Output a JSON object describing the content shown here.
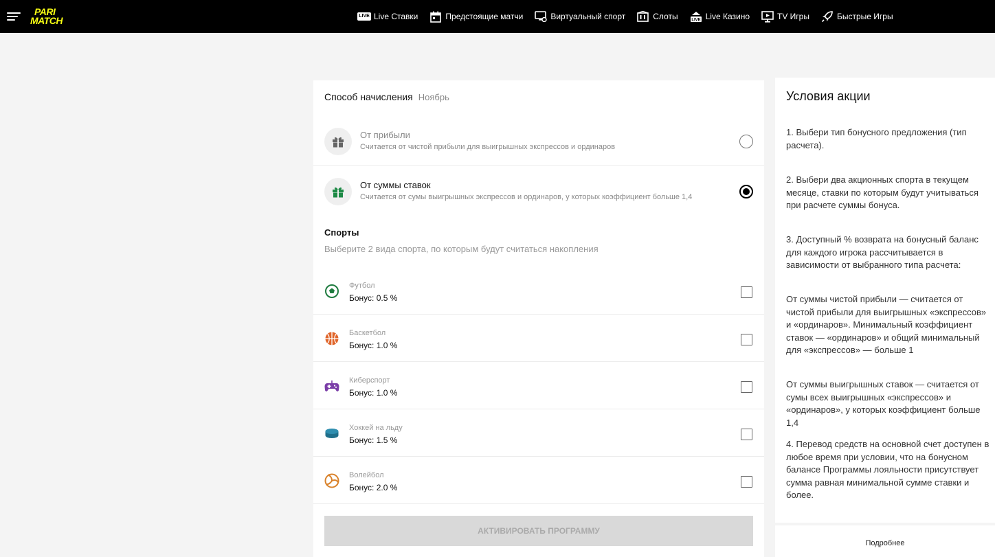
{
  "header": {
    "logo_line1": "PARI",
    "logo_line2": "MATCH",
    "live_badge": "LIVE",
    "nav": [
      {
        "label": "Live Ставки",
        "icon": "live-icon"
      },
      {
        "label": "Предстоящие матчи",
        "icon": "calendar-icon"
      },
      {
        "label": "Виртуальный спорт",
        "icon": "virtual-sport-icon"
      },
      {
        "label": "Слоты",
        "icon": "slots-icon"
      },
      {
        "label": "Live Казино",
        "icon": "live-casino-icon"
      },
      {
        "label": "TV Игры",
        "icon": "tv-icon"
      },
      {
        "label": "Быстрые Игры",
        "icon": "rocket-icon"
      }
    ]
  },
  "accrual": {
    "title": "Способ начисления",
    "month": "Ноябрь",
    "options": [
      {
        "title": "От прибыли",
        "desc": "Считается от чистой прибыли для выигрышных экспрессов и ординаров",
        "selected": false
      },
      {
        "title": "От суммы ставок",
        "desc": "Считается от сумы выигрышных экспрессов и ординаров, у которых коэффициент больше 1,4",
        "selected": true
      }
    ]
  },
  "sports": {
    "title": "Спорты",
    "subtitle": "Выберите 2 вида спорта, по которым будут считаться накопления",
    "items": [
      {
        "name": "Футбол",
        "bonus": "Бонус: 0.5 %",
        "icon": "football-icon",
        "color": "#1e7b3f"
      },
      {
        "name": "Баскетбол",
        "bonus": "Бонус: 1.0 %",
        "icon": "basketball-icon",
        "color": "#e0652a"
      },
      {
        "name": "Киберспорт",
        "bonus": "Бонус: 1.0 %",
        "icon": "gamepad-icon",
        "color": "#7b3ea8"
      },
      {
        "name": "Хоккей на льду",
        "bonus": "Бонус: 1.5 %",
        "icon": "hockey-puck-icon",
        "color": "#1f6f8b"
      },
      {
        "name": "Волейбол",
        "bonus": "Бонус: 2.0 %",
        "icon": "volleyball-icon",
        "color": "#d9822b"
      }
    ]
  },
  "activate_label": "АКТИВИРОВАТЬ ПРОГРАММУ",
  "terms": {
    "title": "Условия акции",
    "paragraphs": [
      "1. Выбери тип бонусного предложения (тип расчета).",
      "2. Выбери два акционных спорта в текущем месяце, ставки по которым будут учитываться при расчете суммы бонуса.",
      "3. Доступный % возврата на бонусный баланс для каждого игрока рассчитывается в зависимости от выбранного типа расчета:",
      "От суммы чистой прибыли —  считается от чистой прибыли для выигрышных «экспрессов» и «ординаров». Минимальный коэффициент ставок — «ординаров» и общий минимальный для «экспрессов» — больше 1",
      "От суммы выигрышных ставок — считается от сумы всех выигрышных «экспрессов» и «ординаров», у которых коэффициент больше 1,4",
      "4. Перевод средств на основной счет доступен в любое время при условии, что на бонусном балансе Программы лояльности присутствует сумма равная минимальной сумме ставки и более."
    ],
    "more_label": "Подробнее"
  }
}
